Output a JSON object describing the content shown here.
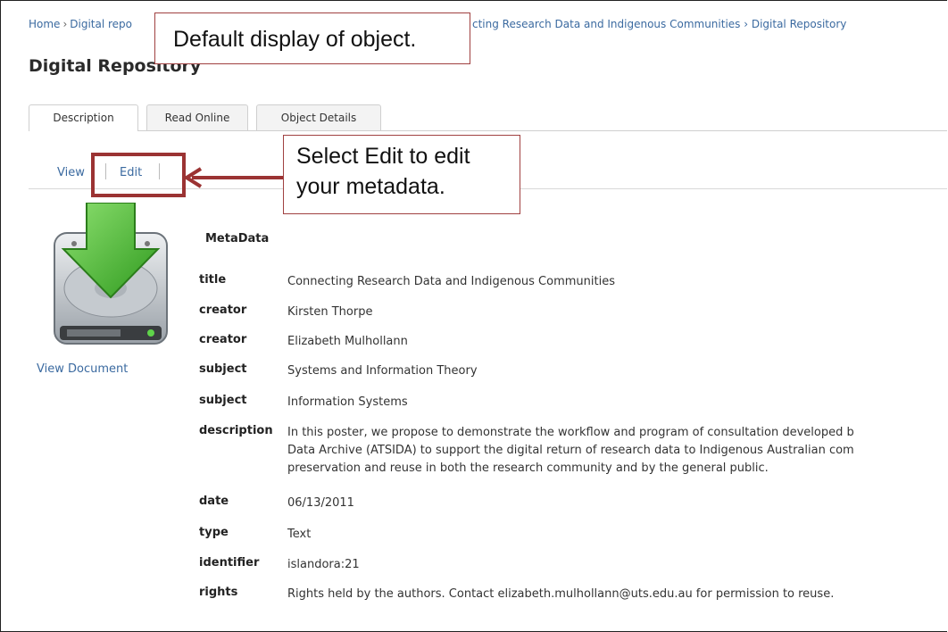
{
  "breadcrumb": {
    "items": [
      "Home",
      "Digital repo"
    ],
    "right": "cting Research Data and Indigenous Communities › Digital Repository"
  },
  "page_title": "Digital Repository",
  "tabs": [
    {
      "label": "Description"
    },
    {
      "label": "Read Online"
    },
    {
      "label": "Object Details"
    }
  ],
  "subtabs": {
    "view": "View",
    "edit": "Edit"
  },
  "callouts": {
    "default_display": "Default display of object.",
    "select_edit_line1": "Select Edit to edit",
    "select_edit_line2": "your metadata."
  },
  "sidebar": {
    "view_document": "View Document"
  },
  "metadata": {
    "heading": "MetaData",
    "rows": [
      {
        "label": "title",
        "value": "Connecting Research Data and Indigenous Communities"
      },
      {
        "label": "creator",
        "value": "Kirsten Thorpe"
      },
      {
        "label": "creator",
        "value": "Elizabeth Mulhollann"
      },
      {
        "label": "subject",
        "value": "Systems and Information Theory"
      },
      {
        "label": "subject",
        "value": "Information Systems"
      },
      {
        "label": "description",
        "lines": [
          "In this poster, we propose to demonstrate the workflow and program of consultation developed b",
          "Data Archive (ATSIDA) to support the digital return of research data to Indigenous Australian com",
          "preservation and reuse in both the research community and by the general public."
        ]
      },
      {
        "label": "date",
        "value": "06/13/2011"
      },
      {
        "label": "type",
        "value": "Text"
      },
      {
        "label": "identifier",
        "value": "islandora:21"
      },
      {
        "label": "rights",
        "value": "Rights held by the authors. Contact elizabeth.mulhollann@uts.edu.au for permission to reuse."
      }
    ]
  },
  "colors": {
    "link": "#3b6aa0",
    "callout_border": "#a04040",
    "highlight": "#9b3333",
    "arrow_green": "#3fae2a"
  },
  "icons": {
    "drive": "download-drive-icon",
    "arrow": "pointer-arrow-icon"
  }
}
